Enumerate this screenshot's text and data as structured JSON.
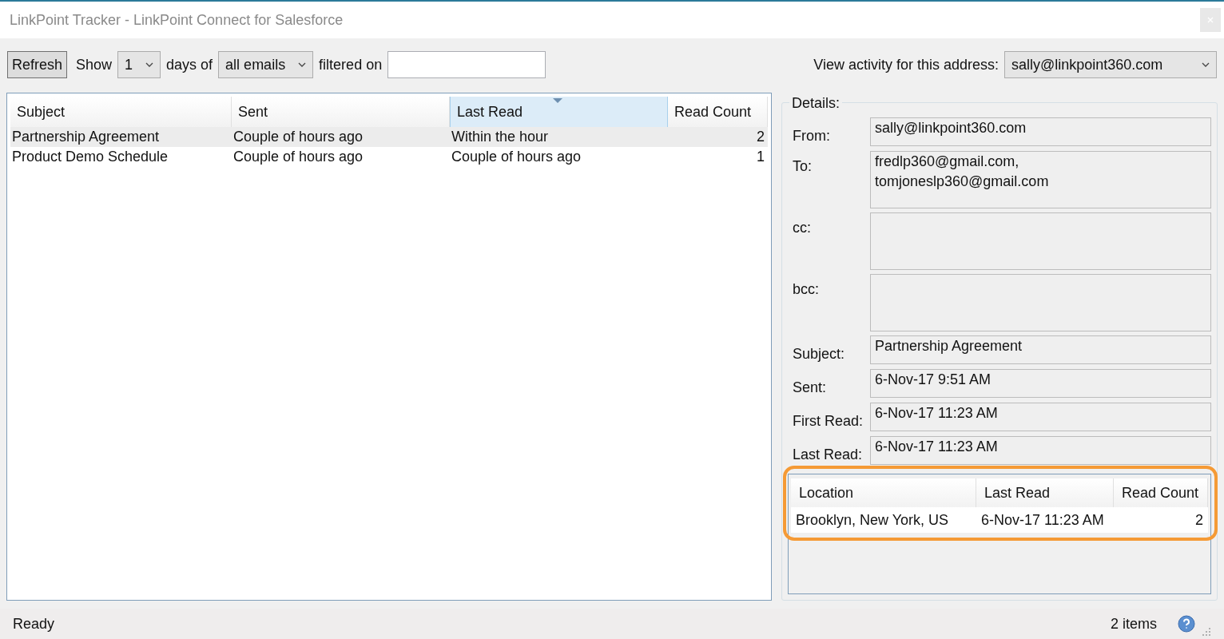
{
  "window": {
    "title": "LinkPoint Tracker - LinkPoint Connect for Salesforce"
  },
  "toolbar": {
    "refresh": "Refresh",
    "show_label": "Show",
    "days_value": "1",
    "days_label": "days of",
    "emails_value": "all emails",
    "filter_label": "filtered on",
    "address_label": "View activity for this address:",
    "address_value": "sally@linkpoint360.com"
  },
  "emails": {
    "columns": [
      {
        "label": "Subject",
        "sorted": false
      },
      {
        "label": "Sent",
        "sorted": false
      },
      {
        "label": "Last Read",
        "sorted": true
      },
      {
        "label": "Read Count",
        "sorted": false
      }
    ],
    "rows": [
      {
        "cells": [
          "Partnership Agreement",
          "Couple of hours ago",
          "Within the hour",
          "2"
        ],
        "selected": true
      },
      {
        "cells": [
          "Product Demo Schedule",
          "Couple of hours ago",
          "Couple of hours ago",
          "1"
        ],
        "selected": false
      }
    ]
  },
  "details": {
    "title": "Details:",
    "fields": [
      {
        "label": "From:",
        "lines": [
          "sally@linkpoint360.com"
        ],
        "kind": "short"
      },
      {
        "label": "To:",
        "lines": [
          "fredlp360@gmail.com,",
          "tomjoneslp360@gmail.com"
        ],
        "kind": "tall"
      },
      {
        "label": "cc:",
        "kind": "tall"
      },
      {
        "label": "bcc:",
        "kind": "tall"
      },
      {
        "label": "Subject:",
        "lines": [
          "Partnership Agreement"
        ],
        "kind": "short"
      },
      {
        "label": "Sent:",
        "lines": [
          "6-Nov-17 9:51 AM"
        ],
        "kind": "short"
      },
      {
        "label": "First Read:",
        "lines": [
          "6-Nov-17 11:23 AM"
        ],
        "kind": "short"
      },
      {
        "label": "Last Read:",
        "lines": [
          "6-Nov-17 11:23 AM"
        ],
        "kind": "short"
      }
    ],
    "locations": {
      "columns": [
        "Location",
        "Last Read",
        "Read Count"
      ],
      "rows": [
        [
          "Brooklyn, New York, US",
          "6-Nov-17 11:23 AM",
          "2"
        ]
      ]
    }
  },
  "status_bar": {
    "status": "Ready",
    "count": "2 items"
  }
}
